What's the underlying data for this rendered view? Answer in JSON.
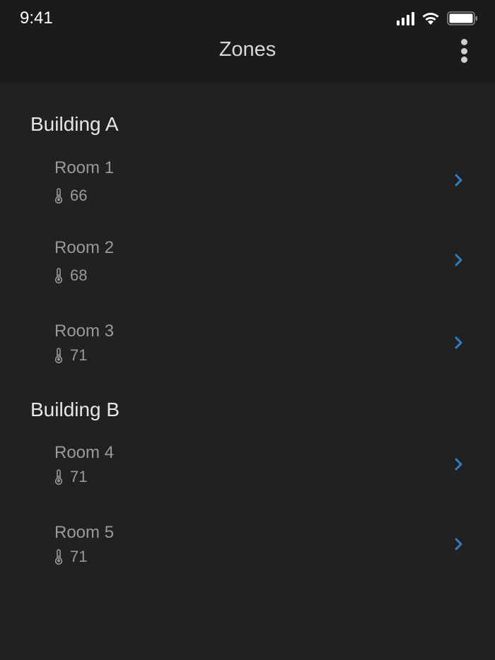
{
  "status_bar": {
    "time": "9:41",
    "icons": [
      "cellular-signal-icon",
      "wifi-icon",
      "battery-icon"
    ]
  },
  "nav": {
    "title": "Zones",
    "more_icon": "more-vertical-icon"
  },
  "colors": {
    "background": "#212121",
    "topbar": "#1b1b1b",
    "accent_chevron": "#2f7fc1",
    "muted_text": "#9a9a9a"
  },
  "sections": [
    {
      "title": "Building A",
      "rooms": [
        {
          "name": "Room 1",
          "temperature": "66"
        },
        {
          "name": "Room 2",
          "temperature": "68"
        },
        {
          "name": "Room 3",
          "temperature": "71"
        }
      ]
    },
    {
      "title": "Building B",
      "rooms": [
        {
          "name": "Room 4",
          "temperature": "71"
        },
        {
          "name": "Room 5",
          "temperature": "71"
        }
      ]
    }
  ]
}
